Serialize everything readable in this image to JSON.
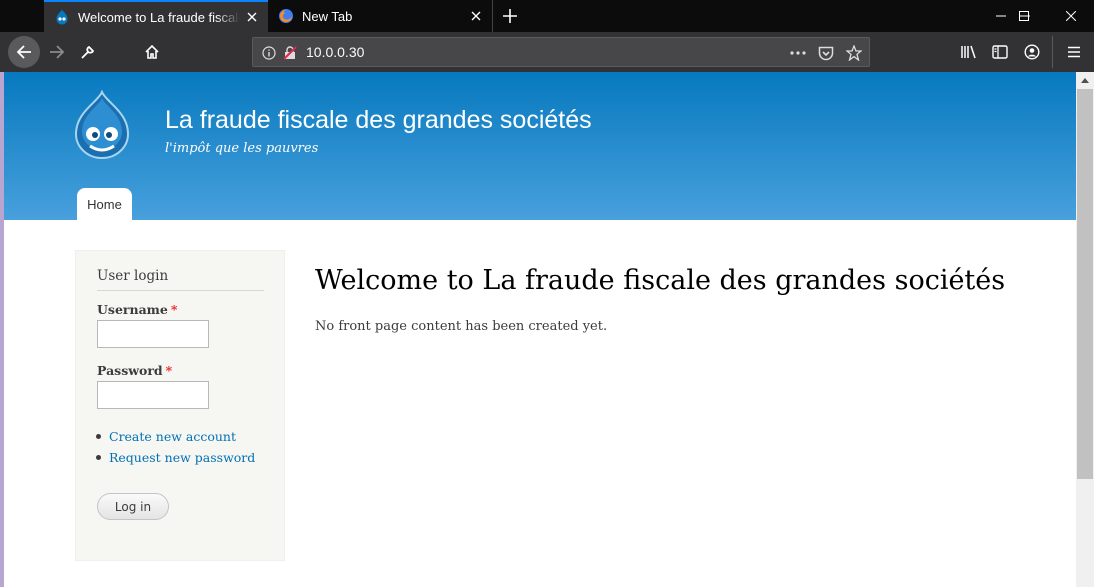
{
  "browser": {
    "tabs": [
      {
        "title": "Welcome to La fraude fiscale des grandes sociétés",
        "active": true,
        "favicon": "drupal-icon"
      },
      {
        "title": "New Tab",
        "active": false,
        "favicon": "firefox-icon"
      }
    ],
    "url": "10.0.0.30",
    "accent_color": "#0a84ff"
  },
  "site": {
    "name": "La fraude fiscale des grandes sociétés",
    "slogan": "l'impôt que les pauvres",
    "nav": [
      {
        "label": "Home"
      }
    ]
  },
  "login_block": {
    "title": "User login",
    "username_label": "Username",
    "password_label": "Password",
    "required_marker": "*",
    "links": [
      {
        "label": "Create new account"
      },
      {
        "label": "Request new password"
      }
    ],
    "submit_label": "Log in"
  },
  "main": {
    "title": "Welcome to La fraude fiscale des grandes sociétés",
    "text": "No front page content has been created yet."
  }
}
